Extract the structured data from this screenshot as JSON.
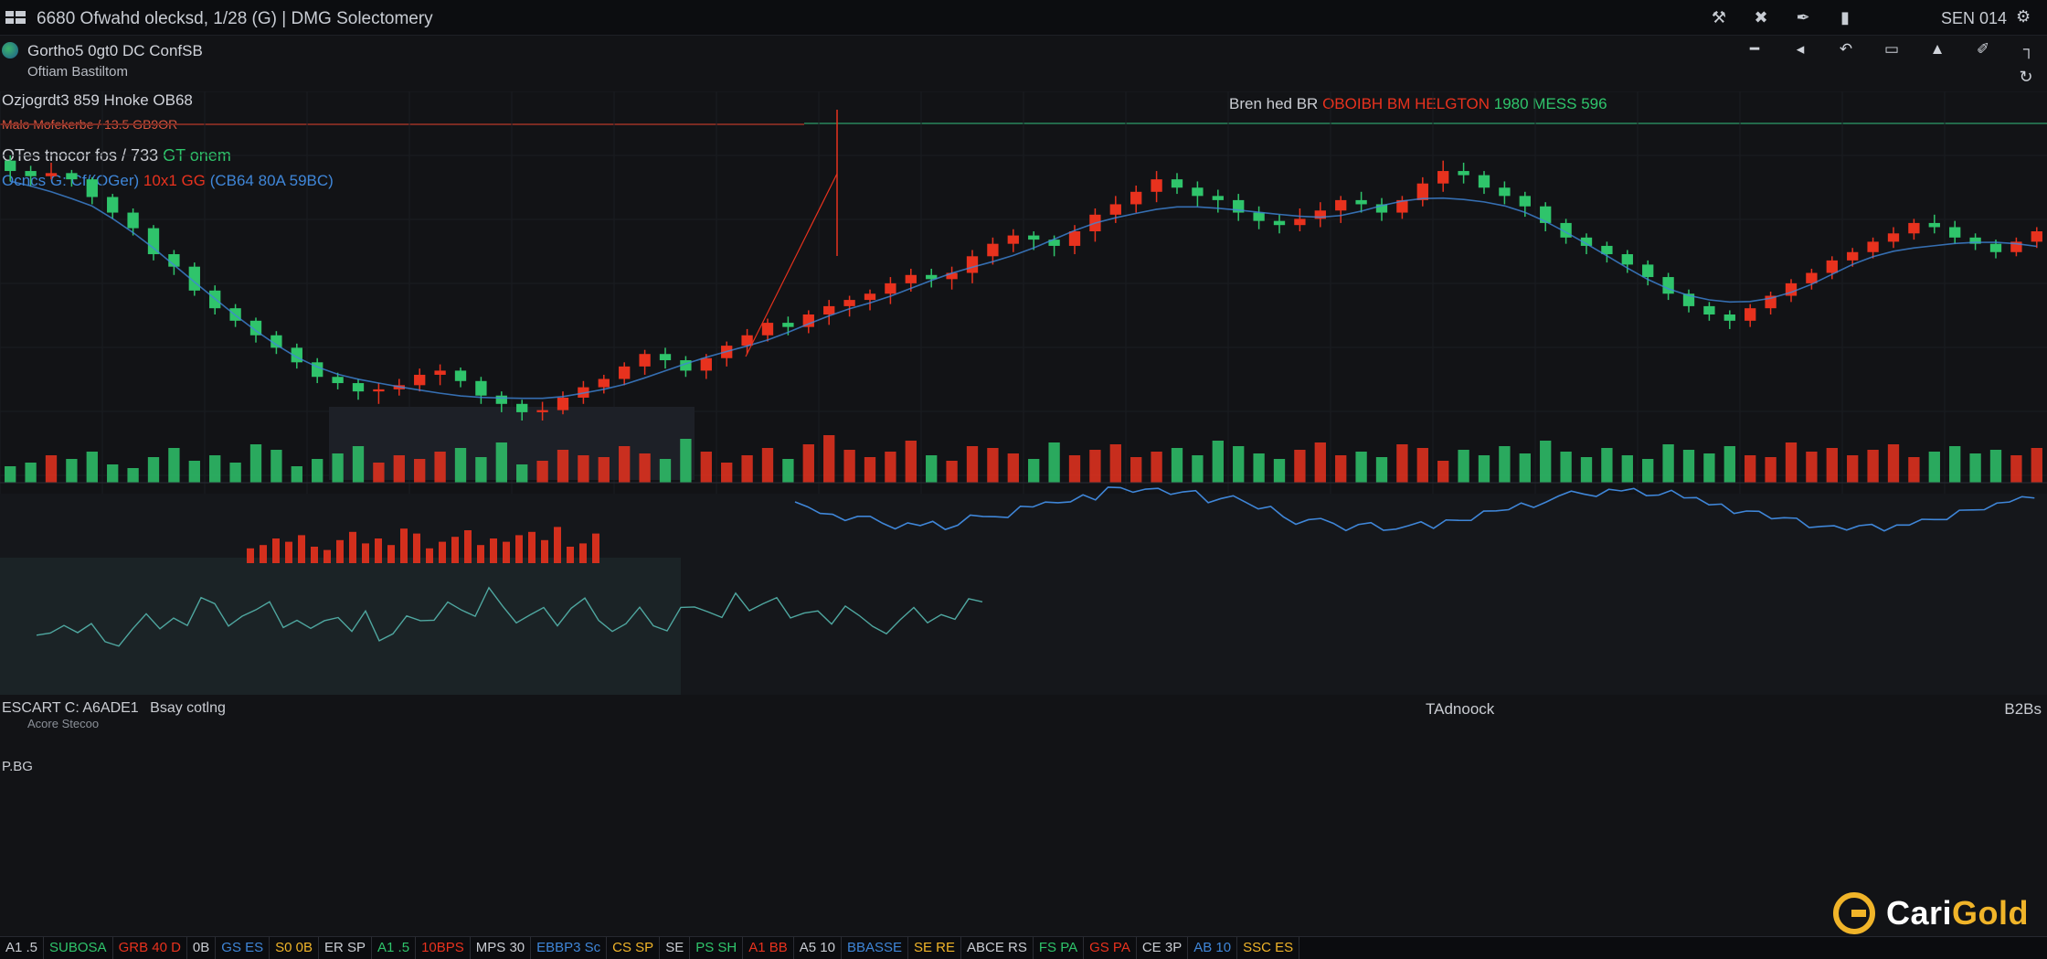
{
  "topbar": {
    "title": "6680 Ofwahd olecksd, 1/28 (G) | DMG Solectomery",
    "ticker": "SEN 014",
    "tool_icons": [
      "wrench-icon",
      "cross-tool-icon",
      "pen-icon",
      "battery-icon"
    ]
  },
  "toolbar": {
    "icons": [
      "draw-line-icon",
      "arrow-left-icon",
      "undo-icon",
      "frame-icon",
      "lock-icon",
      "pencil-icon",
      "bracket-icon"
    ],
    "refresh_icon": "refresh-icon"
  },
  "header": {
    "symbol_line1": "Gortho5 0gt0 DC ConfSB",
    "symbol_line2": "Oftiam Bastiltom",
    "ohlc_line": "Ozjogrdt3 859 Hnoke OB68",
    "indicator_line": "Malo Mofekerbe / 13.5 GB9OR",
    "banner_text": "Bren hed BR",
    "banner_mid": "OBOIBH BM HELGTON",
    "banner_val": "1980 MESS 596",
    "study_line1": "OTes tnocor fos / 733",
    "study_line1b": "GT onem",
    "study_line2": "Ocncs G: Cf/(OGer)",
    "study_line2b": "10x1 GG",
    "study_line2c": "(CB64 80A 59BC)"
  },
  "lower_panel": {
    "label_left": "ESCART C: A6ADE1",
    "label_left2": "Bsay cotlng",
    "label_left3": "Acore Stecoo",
    "label_mid": "TAdnoock",
    "label_right": "B2Bs",
    "small_label": "P.BG"
  },
  "bottombar": {
    "cells": [
      "A1 .5",
      "SUBOSA",
      "GRB 40 D",
      "0B",
      "GS ES",
      "S0 0B",
      "ER SP",
      "A1 .5",
      "10BPS",
      "MPS 30",
      "EBBP3 Sc",
      "CS SP",
      "SE",
      "PS SH",
      "A1 BB",
      "A5 10",
      "BBASSE",
      "SE RE",
      "ABCE RS",
      "FS PA",
      "GS PA",
      "CE 3P",
      "AB 10",
      "SSC ES"
    ]
  },
  "logo": {
    "brand_a": "Cari",
    "brand_b": "Gold"
  },
  "colors": {
    "bull": "#2fc46b",
    "bear": "#e8321e",
    "ma": "#3f86d8",
    "background": "#121316",
    "accent": "#f0b429"
  },
  "chart_data": {
    "type": "candlestick",
    "series": [
      {
        "name": "price",
        "values": [
          [
            430,
            420,
            435,
            410
          ],
          [
            420,
            415,
            425,
            405
          ],
          [
            415,
            418,
            428,
            412
          ],
          [
            418,
            412,
            421,
            405
          ],
          [
            412,
            395,
            414,
            388
          ],
          [
            395,
            380,
            398,
            374
          ],
          [
            380,
            365,
            384,
            358
          ],
          [
            365,
            340,
            368,
            334
          ],
          [
            340,
            328,
            344,
            320
          ],
          [
            328,
            305,
            332,
            300
          ],
          [
            305,
            288,
            310,
            282
          ],
          [
            288,
            276,
            292,
            270
          ],
          [
            276,
            262,
            279,
            255
          ],
          [
            262,
            250,
            266,
            244
          ],
          [
            250,
            236,
            254,
            230
          ],
          [
            236,
            222,
            240,
            216
          ],
          [
            222,
            216,
            226,
            210
          ],
          [
            216,
            208,
            220,
            200
          ],
          [
            208,
            210,
            216,
            196
          ],
          [
            210,
            214,
            220,
            204
          ],
          [
            214,
            224,
            230,
            208
          ],
          [
            224,
            228,
            234,
            214
          ],
          [
            228,
            218,
            231,
            212
          ],
          [
            218,
            204,
            222,
            196
          ],
          [
            204,
            196,
            208,
            188
          ],
          [
            196,
            188,
            200,
            180
          ],
          [
            188,
            190,
            198,
            180
          ],
          [
            190,
            202,
            208,
            186
          ],
          [
            202,
            212,
            218,
            196
          ],
          [
            212,
            220,
            224,
            206
          ],
          [
            220,
            232,
            236,
            214
          ],
          [
            232,
            244,
            248,
            224
          ],
          [
            244,
            238,
            250,
            230
          ],
          [
            238,
            228,
            242,
            222
          ],
          [
            228,
            240,
            244,
            220
          ],
          [
            240,
            252,
            256,
            232
          ],
          [
            252,
            262,
            268,
            244
          ],
          [
            262,
            274,
            278,
            256
          ],
          [
            274,
            270,
            280,
            262
          ],
          [
            270,
            282,
            286,
            264
          ],
          [
            282,
            290,
            296,
            272
          ],
          [
            290,
            296,
            300,
            280
          ],
          [
            296,
            302,
            306,
            286
          ],
          [
            302,
            312,
            318,
            292
          ],
          [
            312,
            320,
            326,
            304
          ],
          [
            320,
            316,
            326,
            308
          ],
          [
            316,
            322,
            328,
            306
          ],
          [
            322,
            338,
            344,
            312
          ],
          [
            338,
            350,
            356,
            330
          ],
          [
            350,
            358,
            364,
            342
          ],
          [
            358,
            354,
            362,
            344
          ],
          [
            354,
            348,
            358,
            338
          ],
          [
            348,
            362,
            368,
            340
          ],
          [
            362,
            378,
            384,
            352
          ],
          [
            378,
            388,
            396,
            370
          ],
          [
            388,
            400,
            406,
            380
          ],
          [
            400,
            412,
            420,
            390
          ],
          [
            412,
            404,
            418,
            398
          ],
          [
            404,
            396,
            410,
            386
          ],
          [
            396,
            392,
            402,
            380
          ],
          [
            392,
            380,
            398,
            372
          ],
          [
            380,
            372,
            386,
            364
          ],
          [
            372,
            368,
            378,
            360
          ],
          [
            368,
            374,
            384,
            362
          ],
          [
            374,
            382,
            390,
            366
          ],
          [
            382,
            392,
            396,
            370
          ],
          [
            392,
            388,
            400,
            380
          ],
          [
            388,
            380,
            394,
            372
          ],
          [
            380,
            392,
            396,
            374
          ],
          [
            392,
            408,
            414,
            386
          ],
          [
            408,
            420,
            430,
            400
          ],
          [
            420,
            416,
            428,
            408
          ],
          [
            416,
            404,
            420,
            398
          ],
          [
            404,
            396,
            410,
            388
          ],
          [
            396,
            386,
            400,
            376
          ],
          [
            386,
            370,
            390,
            362
          ],
          [
            370,
            356,
            374,
            350
          ],
          [
            356,
            348,
            360,
            340
          ],
          [
            348,
            340,
            352,
            332
          ],
          [
            340,
            330,
            344,
            322
          ],
          [
            330,
            318,
            334,
            310
          ],
          [
            318,
            302,
            322,
            296
          ],
          [
            302,
            290,
            306,
            284
          ],
          [
            290,
            282,
            294,
            276
          ],
          [
            282,
            276,
            286,
            268
          ],
          [
            276,
            288,
            292,
            270
          ],
          [
            288,
            300,
            304,
            282
          ],
          [
            300,
            312,
            316,
            294
          ],
          [
            312,
            322,
            326,
            306
          ],
          [
            322,
            334,
            338,
            316
          ],
          [
            334,
            342,
            346,
            328
          ],
          [
            342,
            352,
            356,
            336
          ],
          [
            352,
            360,
            366,
            346
          ],
          [
            360,
            370,
            374,
            354
          ],
          [
            370,
            366,
            378,
            360
          ],
          [
            366,
            356,
            372,
            350
          ],
          [
            356,
            350,
            360,
            344
          ],
          [
            350,
            342,
            354,
            336
          ],
          [
            342,
            352,
            356,
            338
          ],
          [
            352,
            362,
            366,
            346
          ]
        ]
      },
      {
        "name": "volume",
        "values": [
          18,
          22,
          30,
          26,
          34,
          20,
          16,
          28,
          38,
          24,
          30,
          22,
          42,
          36,
          18,
          26,
          32,
          40,
          22,
          30,
          26,
          34,
          38,
          28,
          44,
          20,
          24,
          36,
          30,
          28,
          40,
          32,
          26,
          48,
          34,
          22,
          30,
          38,
          26,
          42,
          52,
          36,
          28,
          34,
          46,
          30,
          24,
          40,
          38,
          32,
          26,
          44,
          30,
          36,
          42,
          28,
          34,
          38,
          30,
          46,
          40,
          32,
          26,
          36,
          44,
          30,
          34,
          28,
          42,
          38,
          24,
          36,
          30,
          40,
          32,
          46,
          34,
          28,
          38,
          30,
          26,
          42,
          36,
          32,
          40,
          30,
          28,
          44,
          34,
          38,
          30,
          36,
          42,
          28,
          34,
          40,
          32,
          36,
          30,
          38
        ]
      }
    ]
  }
}
